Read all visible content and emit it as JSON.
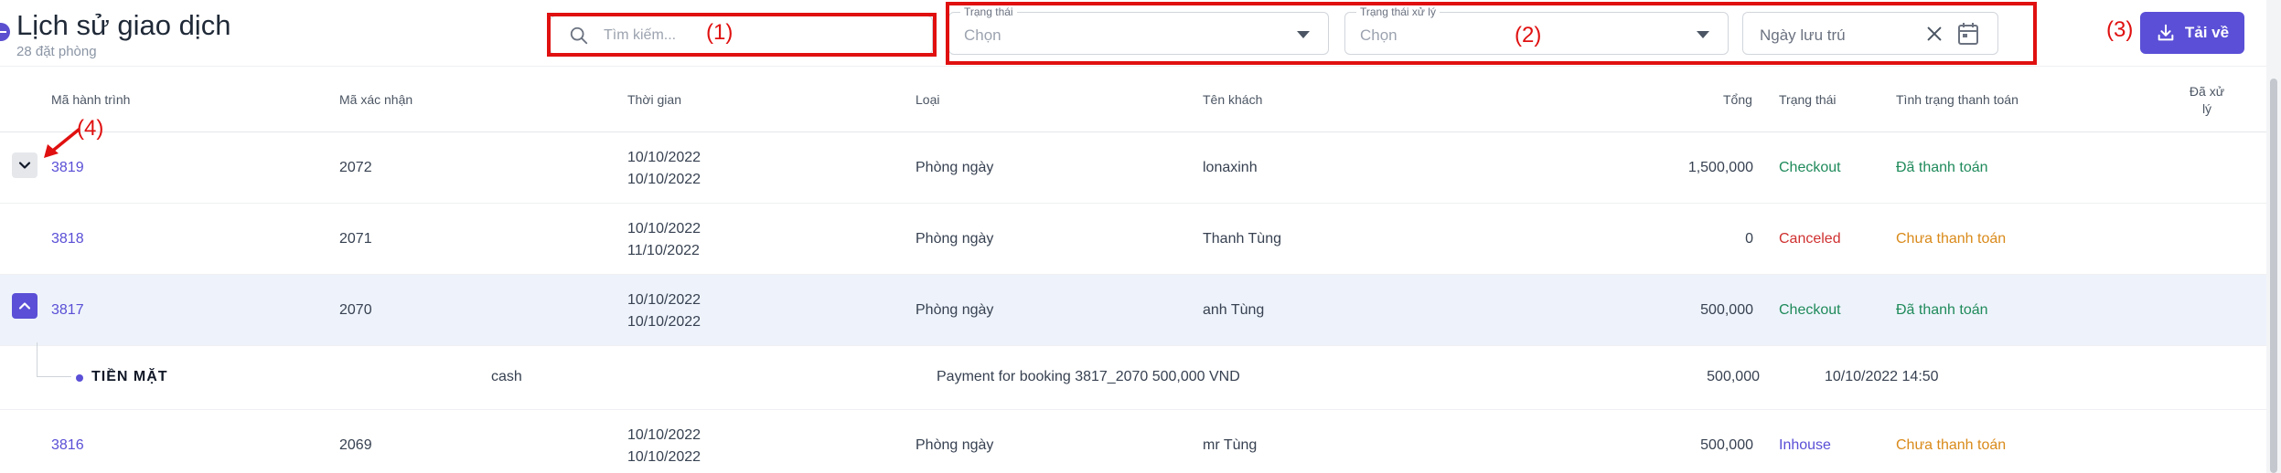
{
  "header": {
    "title": "Lịch sử giao dịch",
    "subtitle": "28 đặt phòng",
    "search_placeholder": "Tìm kiếm...",
    "status_filter": {
      "legend": "Trạng thái",
      "value": "Chọn"
    },
    "process_filter": {
      "legend": "Trạng thái xử lý",
      "value": "Chọn"
    },
    "date_filter": {
      "placeholder": "Ngày lưu trú"
    },
    "download_label": "Tải về"
  },
  "annotations": [
    "(1)",
    "(2)",
    "(3)",
    "(4)"
  ],
  "colors": {
    "accent": "#5a4fd6",
    "annotation": "#e01010",
    "success": "#1f8a5b",
    "danger": "#d03030",
    "warning": "#d98a1a"
  },
  "table": {
    "columns": {
      "journey": "Mã hành trình",
      "confirm": "Mã xác nhận",
      "time": "Thời gian",
      "type": "Loại",
      "guest": "Tên khách",
      "total": "Tổng",
      "status": "Trạng thái",
      "payment": "Tình trạng thanh toán",
      "processed_line1": "Đã xử",
      "processed_line2": "lý"
    },
    "rows": [
      {
        "journey": "3819",
        "confirm": "2072",
        "time_from": "10/10/2022",
        "time_to": "10/10/2022",
        "type": "Phòng ngày",
        "guest": "lonaxinh",
        "total": "1,500,000",
        "status": "Checkout",
        "payment": "Đã thanh toán"
      },
      {
        "journey": "3818",
        "confirm": "2071",
        "time_from": "10/10/2022",
        "time_to": "11/10/2022",
        "type": "Phòng ngày",
        "guest": "Thanh Tùng",
        "total": "0",
        "status": "Canceled",
        "payment": "Chưa thanh toán"
      },
      {
        "journey": "3817",
        "confirm": "2070",
        "time_from": "10/10/2022",
        "time_to": "10/10/2022",
        "type": "Phòng ngày",
        "guest": "anh Tùng",
        "total": "500,000",
        "status": "Checkout",
        "payment": "Đã thanh toán"
      },
      {
        "journey": "3816",
        "confirm": "2069",
        "time_from": "10/10/2022",
        "time_to": "10/10/2022",
        "type": "Phòng ngày",
        "guest": "mr Tùng",
        "total": "500,000",
        "status": "Inhouse",
        "payment": "Chưa thanh toán"
      }
    ],
    "payment_detail": {
      "method": "TIỀN MẶT",
      "code": "cash",
      "description": "Payment for booking 3817_2070 500,000 VND",
      "amount": "500,000",
      "datetime": "10/10/2022 14:50"
    }
  }
}
